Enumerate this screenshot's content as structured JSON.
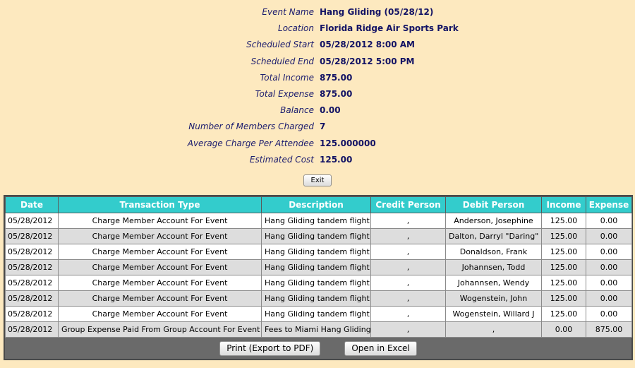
{
  "event": {
    "fields": [
      {
        "label": "Event Name",
        "value": "Hang Gliding (05/28/12)"
      },
      {
        "label": "Location",
        "value": "Florida Ridge Air Sports Park"
      },
      {
        "label": "Scheduled Start",
        "value": "05/28/2012 8:00 AM"
      },
      {
        "label": "Scheduled End",
        "value": "05/28/2012 5:00 PM"
      },
      {
        "label": "Total Income",
        "value": "875.00"
      },
      {
        "label": "Total Expense",
        "value": "875.00"
      },
      {
        "label": "Balance",
        "value": "0.00"
      },
      {
        "label": "Number of Members Charged",
        "value": "7"
      },
      {
        "label": "Average Charge Per Attendee",
        "value": "125.000000"
      },
      {
        "label": "Estimated Cost",
        "value": "125.00"
      }
    ],
    "exit_label": "Exit"
  },
  "transactions": {
    "headers": [
      "Date",
      "Transaction Type",
      "Description",
      "Credit Person",
      "Debit Person",
      "Income",
      "Expense"
    ],
    "rows": [
      [
        "05/28/2012",
        "Charge Member Account For Event",
        "Hang Gliding tandem flight",
        ",",
        "Anderson, Josephine",
        "125.00",
        "0.00"
      ],
      [
        "05/28/2012",
        "Charge Member Account For Event",
        "Hang Gliding tandem flight",
        ",",
        "Dalton, Darryl \"Daring\"",
        "125.00",
        "0.00"
      ],
      [
        "05/28/2012",
        "Charge Member Account For Event",
        "Hang Gliding tandem flight",
        ",",
        "Donaldson, Frank",
        "125.00",
        "0.00"
      ],
      [
        "05/28/2012",
        "Charge Member Account For Event",
        "Hang Gliding tandem flight",
        ",",
        "Johannsen, Todd",
        "125.00",
        "0.00"
      ],
      [
        "05/28/2012",
        "Charge Member Account For Event",
        "Hang Gliding tandem flight",
        ",",
        "Johannsen, Wendy",
        "125.00",
        "0.00"
      ],
      [
        "05/28/2012",
        "Charge Member Account For Event",
        "Hang Gliding tandem flight",
        ",",
        "Wogenstein, John",
        "125.00",
        "0.00"
      ],
      [
        "05/28/2012",
        "Charge Member Account For Event",
        "Hang Gliding tandem flight",
        ",",
        "Wogenstein, Willard J",
        "125.00",
        "0.00"
      ],
      [
        "05/28/2012",
        "Group Expense Paid From Group Account For Event",
        "Fees to Miami Hang Gliding",
        ",",
        ",",
        "0.00",
        "875.00"
      ]
    ],
    "print_label": "Print (Export to PDF)",
    "excel_label": "Open in Excel"
  },
  "colors": {
    "page_background": "#fde9bf",
    "header_background": "#33cccc",
    "label_text": "#1c1c6e"
  }
}
